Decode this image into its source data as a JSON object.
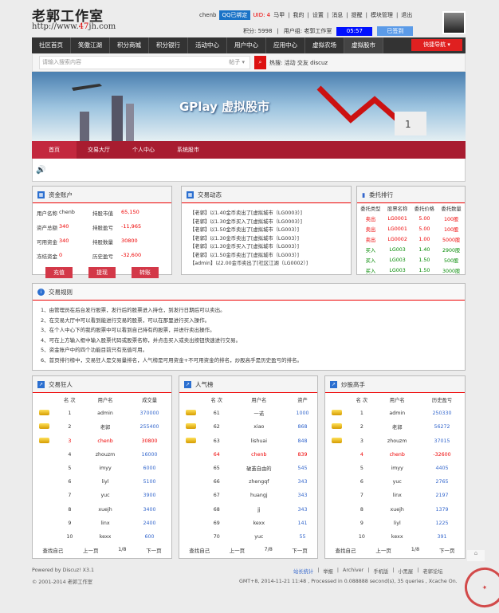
{
  "header": {
    "logo": "老郭工作室",
    "url_prefix": "http://www.",
    "url_mid": "47",
    "url_suffix": "jh.com",
    "username": "chenb",
    "qq": "QQ已绑定",
    "uid": "UID: 4",
    "links": [
      "马甲",
      "我的",
      "设置",
      "消息",
      "提醒",
      "模块管理",
      "退出"
    ],
    "credits": "积分: 5998",
    "group": "用户组: 老郭工作室",
    "timer": "05:57",
    "sign": "已签到"
  },
  "nav": {
    "items": [
      "社区首页",
      "笑傲江湖",
      "积分商城",
      "积分银行",
      "活动中心",
      "用户中心",
      "应用中心",
      "虚拟农场",
      "虚拟股市"
    ],
    "quick": "快捷导航 ▾"
  },
  "search": {
    "placeholder": "请输入搜索内容",
    "type": "帖子 ▾",
    "hot_label": "热搜:",
    "hot": [
      "活动",
      "交友",
      "discuz"
    ]
  },
  "banner": {
    "title": "GPlay 虚拟股市"
  },
  "subnav": [
    "首页",
    "交易大厅",
    "个人中心",
    "系统股市"
  ],
  "account": {
    "title": "资金账户",
    "rows": [
      [
        "用户名称",
        "chenb",
        "持股市值",
        "65,150"
      ],
      [
        "资产总额",
        "340",
        "持股盈亏",
        "-11,965"
      ],
      [
        "可用资金",
        "340",
        "持股数量",
        "30800"
      ],
      [
        "冻结资金",
        "0",
        "历史盈亏",
        "-32,600"
      ]
    ],
    "buttons": [
      "充值",
      "提现",
      "转账"
    ]
  },
  "news": {
    "title": "交易动态",
    "items": [
      "【老郭】以1.40金币卖出了[虚拟城市（LG0003）]",
      "【老郭】以1.30金币买入了[虚拟城市（LG0003）]",
      "【老郭】以1.50金币卖出了[虚拟城市（LG003）]",
      "【老郭】以1.30金币卖出了[虚拟城市（LG003）]",
      "【老郭】以1.30金币买入了[虚拟城市（LG003）]",
      "【老郭】以1.50金币卖出了[虚拟城市（LG003）]",
      "【admin】以2.00金币卖出了[社区江湖（LG0002）]"
    ]
  },
  "orders": {
    "title": "委托排行",
    "headers": [
      "委托类型",
      "股票名称",
      "委托价格",
      "委托数量"
    ],
    "rows": [
      [
        "卖出",
        "LG0001",
        "5.00",
        "100股"
      ],
      [
        "卖出",
        "LG0001",
        "5.00",
        "100股"
      ],
      [
        "卖出",
        "LG0002",
        "1.00",
        "5000股"
      ],
      [
        "买入",
        "LG003",
        "1.40",
        "2900股"
      ],
      [
        "买入",
        "LG003",
        "1.50",
        "500股"
      ],
      [
        "买入",
        "LG003",
        "1.50",
        "3000股"
      ]
    ]
  },
  "rules": {
    "title": "交易规则",
    "items": [
      "1、由管理员在后台发行股票，发行后的股票进入持仓，到发行日期后可以卖出。",
      "2、在交易大厅中可以看到能进行交易的股票，可以在那里进行买入操作。",
      "3、在个人中心下的我的股票中可以看到自己持有的股票，并进行卖出操作。",
      "4、可在上方输入框中输入股票代码或股票名称，并点击买入或卖出按钮快速进行交易。",
      "5、资金账户中的四个功能目前只有充值可用。",
      "6、首页排行榜中，交易狂人是交易量排名，人气榜是可用资金+不可用资金的排名，炒股高手是历史盈亏的排名。"
    ]
  },
  "tables": [
    {
      "title": "交易狂人",
      "headers": [
        "名 次",
        "用户名",
        "成交量"
      ],
      "rows": [
        [
          "1",
          "admin",
          "370000"
        ],
        [
          "2",
          "老郭",
          "255400"
        ],
        [
          "3",
          "chenb",
          "30800"
        ],
        [
          "4",
          "zhouzm",
          "16000"
        ],
        [
          "5",
          "imyy",
          "6000"
        ],
        [
          "6",
          "liyl",
          "5100"
        ],
        [
          "7",
          "yuc",
          "3900"
        ],
        [
          "8",
          "xuejh",
          "3400"
        ],
        [
          "9",
          "linx",
          "2400"
        ],
        [
          "10",
          "kexx",
          "600"
        ]
      ],
      "highlight": 2,
      "pager": [
        "查找自己",
        "上一页",
        "1/8",
        "下一页"
      ]
    },
    {
      "title": "人气榜",
      "headers": [
        "名 次",
        "用户名",
        "资产"
      ],
      "rows": [
        [
          "61",
          "一诺",
          "1000"
        ],
        [
          "62",
          "xiao",
          "868"
        ],
        [
          "63",
          "lishuai",
          "848"
        ],
        [
          "64",
          "chenb",
          "839"
        ],
        [
          "65",
          "破茧自由的",
          "545"
        ],
        [
          "66",
          "zhengqf",
          "343"
        ],
        [
          "67",
          "huangj",
          "343"
        ],
        [
          "68",
          "jj",
          "343"
        ],
        [
          "69",
          "kexx",
          "141"
        ],
        [
          "70",
          "yuc",
          "55"
        ]
      ],
      "highlight": 3,
      "pager": [
        "查找自己",
        "上一页",
        "7/8",
        "下一页"
      ]
    },
    {
      "title": "炒股高手",
      "headers": [
        "名 次",
        "用户名",
        "历史盈亏"
      ],
      "rows": [
        [
          "1",
          "admin",
          "250330"
        ],
        [
          "2",
          "老郭",
          "56272"
        ],
        [
          "3",
          "zhouzm",
          "37015"
        ],
        [
          "4",
          "chenb",
          "-32600"
        ],
        [
          "5",
          "imyy",
          "4405"
        ],
        [
          "6",
          "yuc",
          "2765"
        ],
        [
          "7",
          "linx",
          "2197"
        ],
        [
          "8",
          "xuejh",
          "1379"
        ],
        [
          "9",
          "liyl",
          "1225"
        ],
        [
          "10",
          "kexx",
          "391"
        ]
      ],
      "highlight": 3,
      "pager": [
        "查找自己",
        "上一页",
        "1/8",
        "下一页"
      ]
    }
  ],
  "footer": {
    "powered": "Powered by Discuz! X3.1",
    "copyright": "© 2001-2014 老郭工作室",
    "links": [
      "站长统计",
      "举报",
      "Archiver",
      "手机版",
      "小黑屋",
      "老郭论坛"
    ],
    "stats": "GMT+8, 2014-11-21 11:48 , Processed in 0.088888 second(s), 35 queries , Xcache On."
  },
  "stamp": "老郭工作室"
}
